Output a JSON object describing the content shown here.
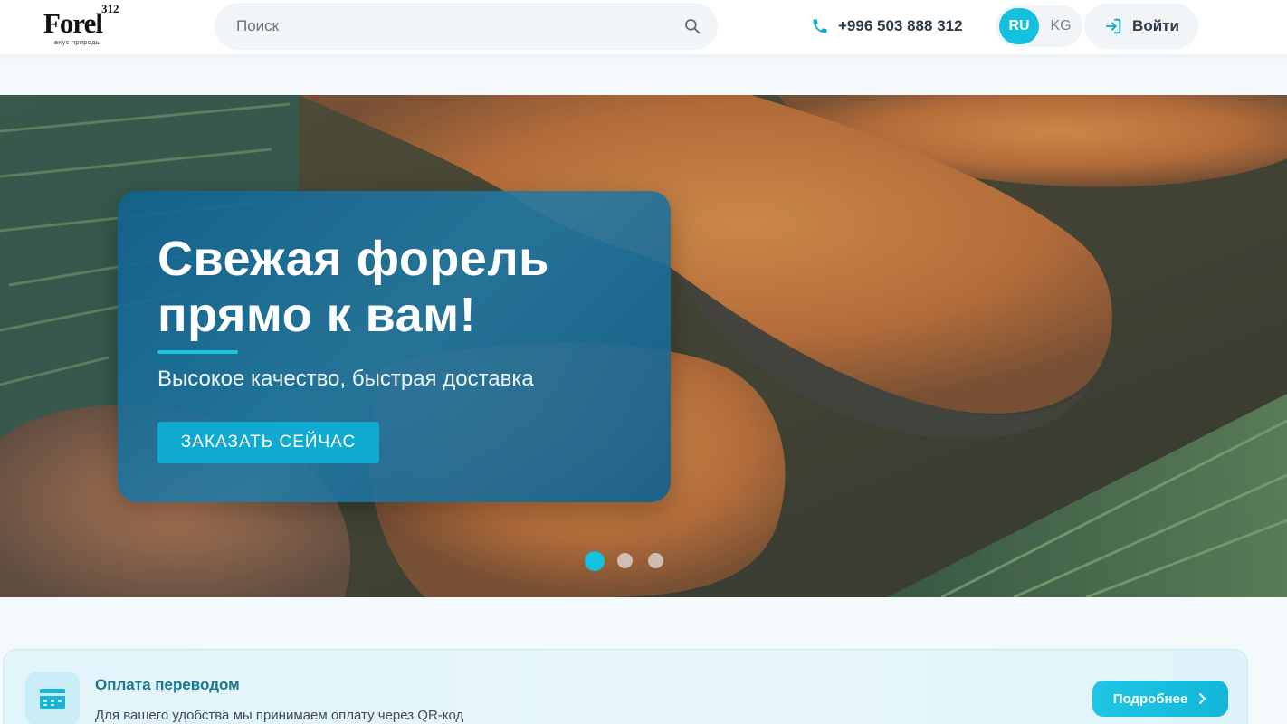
{
  "header": {
    "logo": {
      "number": "312",
      "word": "Forel",
      "tagline": "вкус природы"
    },
    "search": {
      "placeholder": "Поиск"
    },
    "phone": {
      "number": "+996 503 888 312"
    },
    "languages": [
      {
        "code": "RU",
        "active": true
      },
      {
        "code": "KG",
        "active": false
      }
    ],
    "login_label": "Войти"
  },
  "hero": {
    "title": "Свежая форель прямо к вам!",
    "subtitle": "Высокое качество, быстрая доставка",
    "cta_label": "ЗАКАЗАТЬ СЕЙЧАС",
    "slides_total": 3,
    "active_slide": 1
  },
  "payment_banner": {
    "title": "Оплата переводом",
    "text": "Для вашего удобства мы принимаем оплату через QR-код",
    "button_label": "Подробнее"
  },
  "colors": {
    "accent": "#13c0dd",
    "card_blue": "#1a6e9e",
    "header_bg": "#ffffff",
    "page_bg": "#f4fafc"
  },
  "icons": {
    "search": "search-icon",
    "phone": "phone-icon",
    "login": "login-icon",
    "payment": "payment-card-icon",
    "chevron": "chevron-right-icon"
  }
}
